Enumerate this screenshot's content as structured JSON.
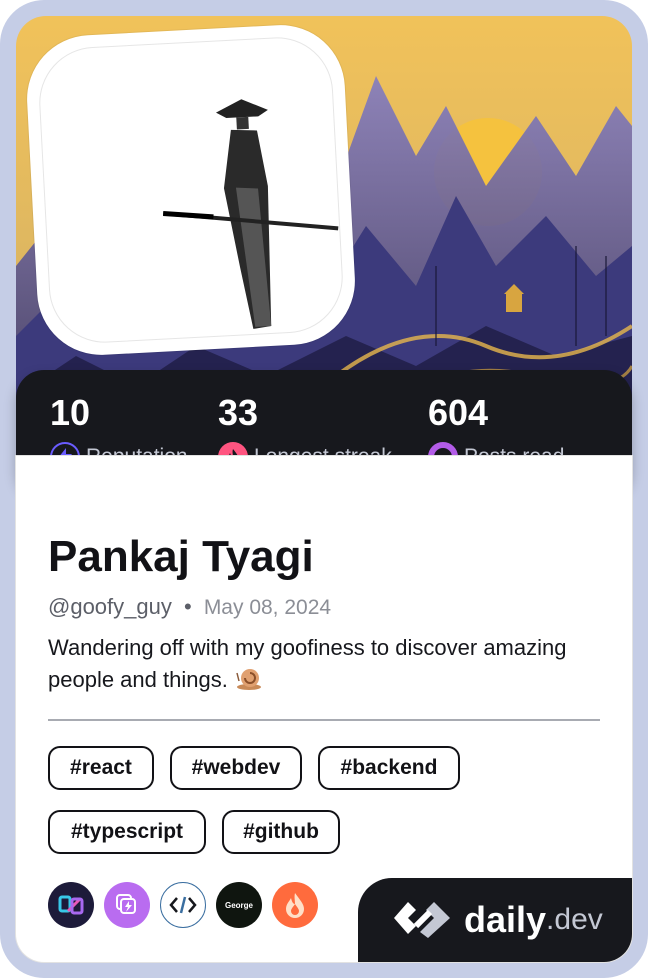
{
  "profile": {
    "name": "Pankaj Tyagi",
    "handle": "@goofy_guy",
    "separator": "•",
    "joined": "May 08, 2024",
    "bio": "Wandering off with my goofiness to discover amazing people and things."
  },
  "stats": [
    {
      "value": "10",
      "label": "Reputation",
      "icon": "lightning-icon",
      "color": "#6a5cff"
    },
    {
      "value": "33",
      "label": "Longest streak",
      "icon": "flame-icon",
      "color": "#ff5480"
    },
    {
      "value": "604",
      "label": "Posts read",
      "icon": "reading-icon",
      "color": "#b35ce8"
    }
  ],
  "tags": [
    "#react",
    "#webdev",
    "#backend",
    "#typescript",
    "#github"
  ],
  "sources": [
    {
      "icon": "source-logo-gradient-icon"
    },
    {
      "icon": "source-lightning-stack-icon"
    },
    {
      "icon": "source-code-brackets-icon"
    },
    {
      "icon": "source-george-icon",
      "label": "George"
    },
    {
      "icon": "source-fire-icon"
    }
  ],
  "brand": {
    "name": "daily",
    "suffix": ".dev",
    "icon": "dailydev-logo-icon"
  },
  "colors": {
    "stats_bg": "#17181d",
    "card_border": "#c5cde6",
    "cover_gold": "#e8b84a",
    "cover_purple": "#5b5aa8"
  }
}
